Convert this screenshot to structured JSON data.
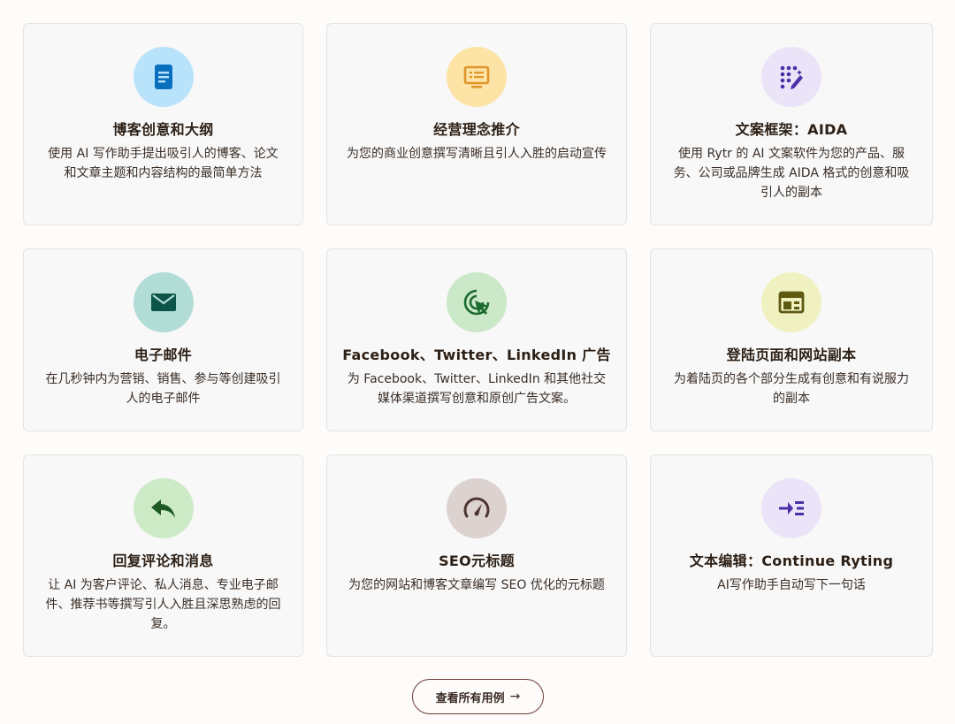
{
  "cards": [
    {
      "title": "博客创意和大纲",
      "desc": "使用 AI 写作助手提出吸引人的博客、论文和文章主题和内容结构的最简单方法",
      "icon": "document-icon",
      "bg": "#b9e3fb",
      "fg": "#0a6fbd"
    },
    {
      "title": "经营理念推介",
      "desc": "为您的商业创意撰写清晰且引人入胜的启动宣传",
      "icon": "presentation-icon",
      "bg": "#fde3a6",
      "fg": "#e0952a"
    },
    {
      "title": "文案框架：AIDA",
      "desc": "使用 Rytr 的 AI 文案软件为您的产品、服务、公司或品牌生成 AIDA 格式的创意和吸引人的副本",
      "icon": "magic-grid-icon",
      "bg": "#ebe3f8",
      "fg": "#4b2fa8"
    },
    {
      "title": "电子邮件",
      "desc": "在几秒钟内为营销、销售、参与等创建吸引人的电子邮件",
      "icon": "mail-icon",
      "bg": "#b1ddd6",
      "fg": "#0d5448"
    },
    {
      "title": "Facebook、Twitter、LinkedIn 广告",
      "desc": "为 Facebook、Twitter、LinkedIn 和其他社交媒体渠道撰写创意和原创广告文案。",
      "icon": "target-click-icon",
      "bg": "#cbe8c8",
      "fg": "#1d6b2f"
    },
    {
      "title": "登陆页面和网站副本",
      "desc": "为着陆页的各个部分生成有创意和有说服力的副本",
      "icon": "web-layout-icon",
      "bg": "#f0f1c0",
      "fg": "#5e5a12"
    },
    {
      "title": "回复评论和消息",
      "desc": "让 AI 为客户评论、私人消息、专业电子邮件、推荐书等撰写引人入胜且深思熟虑的回复。",
      "icon": "reply-icon",
      "bg": "#cdeac7",
      "fg": "#1e5a24"
    },
    {
      "title": "SEO元标题",
      "desc": "为您的网站和博客文章编写 SEO 优化的元标题",
      "icon": "speedometer-icon",
      "bg": "#dcd2cf",
      "fg": "#4c3430"
    },
    {
      "title": "文本编辑：Continue Ryting",
      "desc": "AI写作助手自动写下一句话",
      "icon": "continue-text-icon",
      "bg": "#ebe3f8",
      "fg": "#4b2fa8"
    }
  ],
  "view_all": {
    "label": "查看所有用例",
    "arrow": "→"
  }
}
